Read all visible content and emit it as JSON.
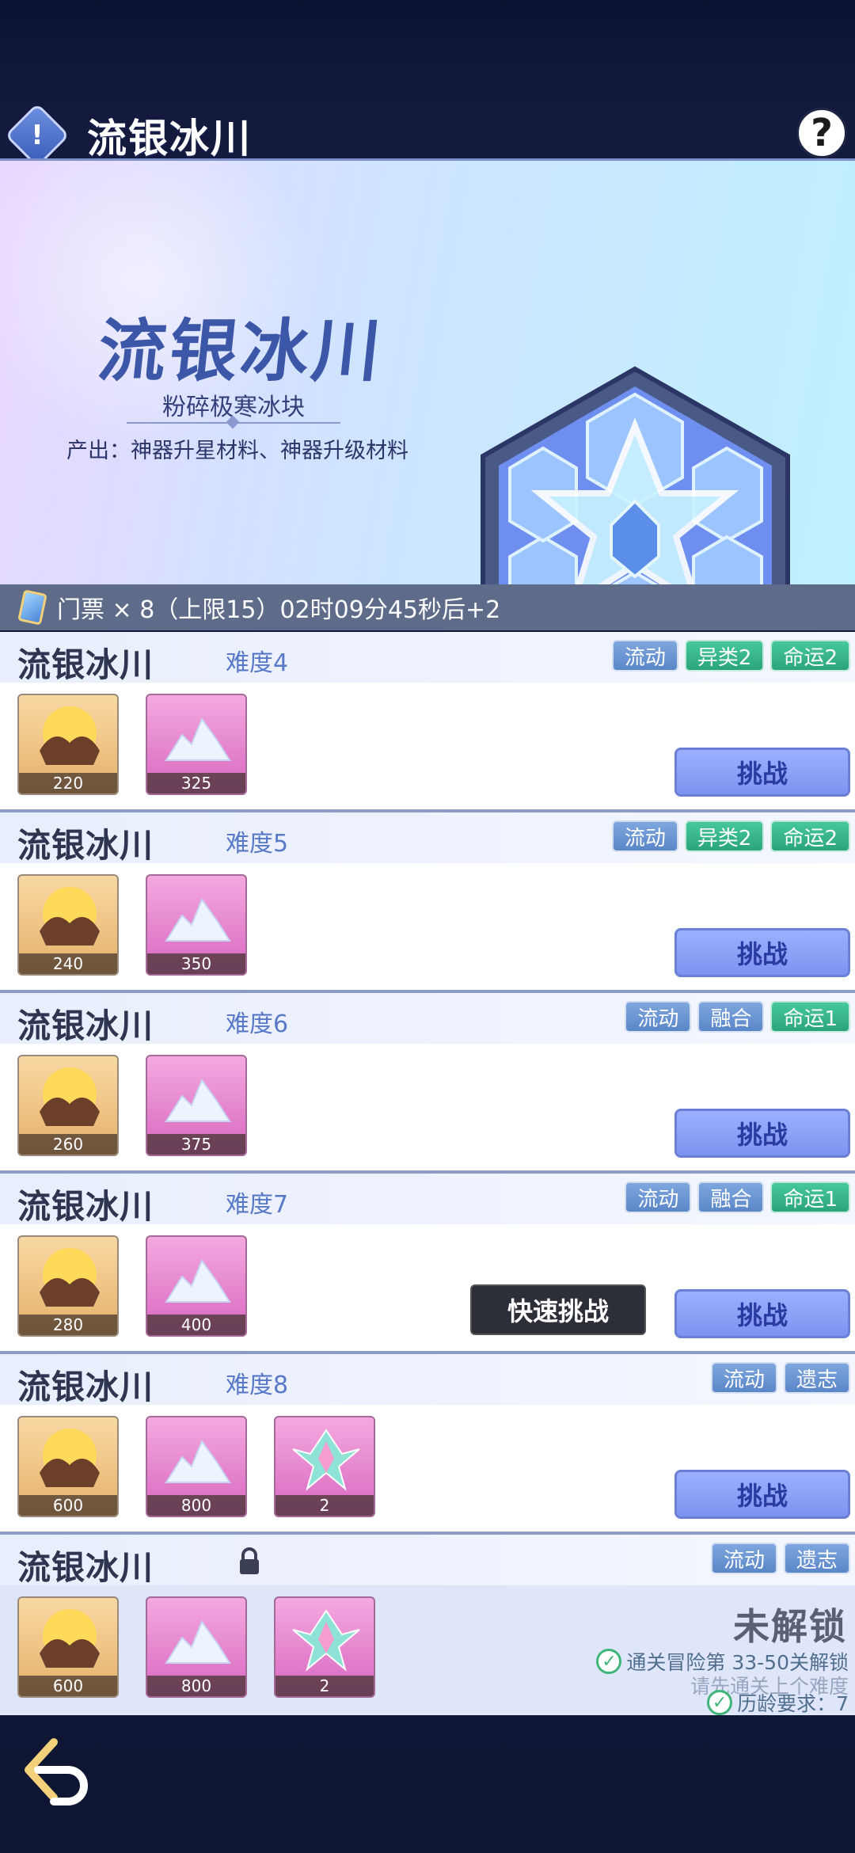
{
  "header": {
    "title": "流银冰川"
  },
  "banner": {
    "title": "流银冰川",
    "subtitle": "粉碎极寒冰块",
    "description": "产出：神器升星材料、神器升级材料"
  },
  "ticket": {
    "text": "门票 × 8（上限15）02时09分45秒后+2"
  },
  "stages": [
    {
      "name": "流银冰川",
      "difficulty": "难度4",
      "tags": [
        "流动",
        "异类2",
        "命运2"
      ],
      "items": [
        "220",
        "325"
      ],
      "button": "挑战"
    },
    {
      "name": "流银冰川",
      "difficulty": "难度5",
      "tags": [
        "流动",
        "异类2",
        "命运2"
      ],
      "items": [
        "240",
        "350"
      ],
      "button": "挑战"
    },
    {
      "name": "流银冰川",
      "difficulty": "难度6",
      "tags": [
        "流动",
        "融合",
        "命运1"
      ],
      "items": [
        "260",
        "375"
      ],
      "button": "挑战"
    },
    {
      "name": "流银冰川",
      "difficulty": "难度7",
      "tags": [
        "流动",
        "融合",
        "命运1"
      ],
      "items": [
        "280",
        "400"
      ],
      "button": "挑战",
      "quick": "快速挑战"
    },
    {
      "name": "流银冰川",
      "difficulty": "难度8",
      "tags": [
        "流动",
        "遗志"
      ],
      "items": [
        "600",
        "800",
        "2"
      ],
      "button": "挑战"
    },
    {
      "name": "流银冰川",
      "tags": [
        "流动",
        "遗志"
      ],
      "items": [
        "600",
        "800",
        "2"
      ],
      "locked_title": "未解锁",
      "req1": "通关冒险第 33-50关解锁",
      "req2": "请先通关上个难度",
      "req3": "历龄要求：7"
    }
  ],
  "colors": {
    "tag_blue": "#6b93d2",
    "tag_green": "#33b585",
    "challenge": "#8ea2f8"
  }
}
